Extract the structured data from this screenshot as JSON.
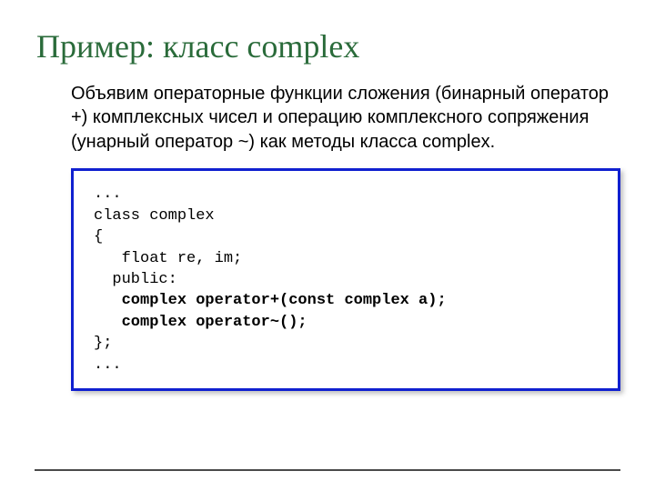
{
  "title": "Пример: класс complex",
  "paragraph": "Объявим операторные функции сложения (бинарный оператор +) комплексных чисел и операцию комплексного сопряжения (унарный оператор ~) как методы класса complex.",
  "code": {
    "line1": "...",
    "line2": "class complex",
    "line3": "{",
    "line4": "   float re, im;",
    "line5": "  public:",
    "line6": "   complex operator+(const complex a);",
    "line7": "   complex operator~();",
    "line8": "};",
    "line9": "..."
  }
}
